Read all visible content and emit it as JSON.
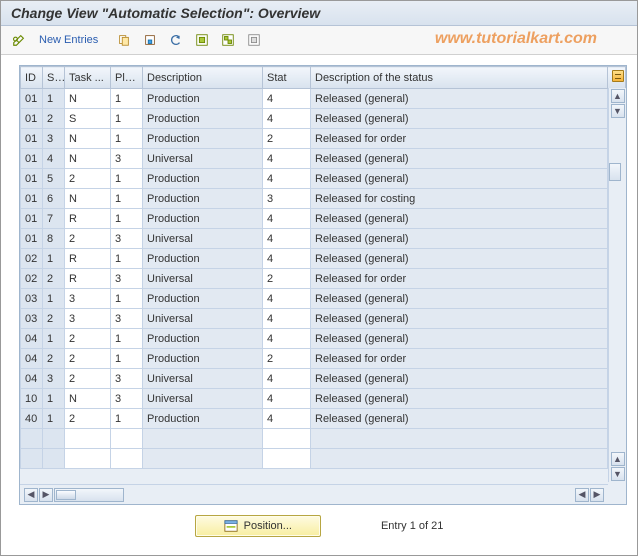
{
  "title": "Change View \"Automatic Selection\": Overview",
  "watermark": "www.tutorialkart.com",
  "toolbar": {
    "new_entries": "New Entries"
  },
  "columns": {
    "id": "ID",
    "sp": "SP",
    "task": "Task ...",
    "plan": "Pla...",
    "desc": "Description",
    "stat": "Stat",
    "sdesc": "Description of the status"
  },
  "rows": [
    {
      "id": "01",
      "sp": "1",
      "task": "N",
      "plan": "1",
      "desc": "Production",
      "stat": "4",
      "sdesc": "Released (general)"
    },
    {
      "id": "01",
      "sp": "2",
      "task": "S",
      "plan": "1",
      "desc": "Production",
      "stat": "4",
      "sdesc": "Released (general)"
    },
    {
      "id": "01",
      "sp": "3",
      "task": "N",
      "plan": "1",
      "desc": "Production",
      "stat": "2",
      "sdesc": "Released for order"
    },
    {
      "id": "01",
      "sp": "4",
      "task": "N",
      "plan": "3",
      "desc": "Universal",
      "stat": "4",
      "sdesc": "Released (general)"
    },
    {
      "id": "01",
      "sp": "5",
      "task": "2",
      "plan": "1",
      "desc": "Production",
      "stat": "4",
      "sdesc": "Released (general)"
    },
    {
      "id": "01",
      "sp": "6",
      "task": "N",
      "plan": "1",
      "desc": "Production",
      "stat": "3",
      "sdesc": "Released for costing"
    },
    {
      "id": "01",
      "sp": "7",
      "task": "R",
      "plan": "1",
      "desc": "Production",
      "stat": "4",
      "sdesc": "Released (general)"
    },
    {
      "id": "01",
      "sp": "8",
      "task": "2",
      "plan": "3",
      "desc": "Universal",
      "stat": "4",
      "sdesc": "Released (general)"
    },
    {
      "id": "02",
      "sp": "1",
      "task": "R",
      "plan": "1",
      "desc": "Production",
      "stat": "4",
      "sdesc": "Released (general)"
    },
    {
      "id": "02",
      "sp": "2",
      "task": "R",
      "plan": "3",
      "desc": "Universal",
      "stat": "2",
      "sdesc": "Released for order"
    },
    {
      "id": "03",
      "sp": "1",
      "task": "3",
      "plan": "1",
      "desc": "Production",
      "stat": "4",
      "sdesc": "Released (general)"
    },
    {
      "id": "03",
      "sp": "2",
      "task": "3",
      "plan": "3",
      "desc": "Universal",
      "stat": "4",
      "sdesc": "Released (general)"
    },
    {
      "id": "04",
      "sp": "1",
      "task": "2",
      "plan": "1",
      "desc": "Production",
      "stat": "4",
      "sdesc": "Released (general)"
    },
    {
      "id": "04",
      "sp": "2",
      "task": "2",
      "plan": "1",
      "desc": "Production",
      "stat": "2",
      "sdesc": "Released for order"
    },
    {
      "id": "04",
      "sp": "3",
      "task": "2",
      "plan": "3",
      "desc": "Universal",
      "stat": "4",
      "sdesc": "Released (general)"
    },
    {
      "id": "10",
      "sp": "1",
      "task": "N",
      "plan": "3",
      "desc": "Universal",
      "stat": "4",
      "sdesc": "Released (general)"
    },
    {
      "id": "40",
      "sp": "1",
      "task": "2",
      "plan": "1",
      "desc": "Production",
      "stat": "4",
      "sdesc": "Released (general)"
    }
  ],
  "footer": {
    "position_label": "Position...",
    "entry_label": "Entry 1 of 21"
  }
}
